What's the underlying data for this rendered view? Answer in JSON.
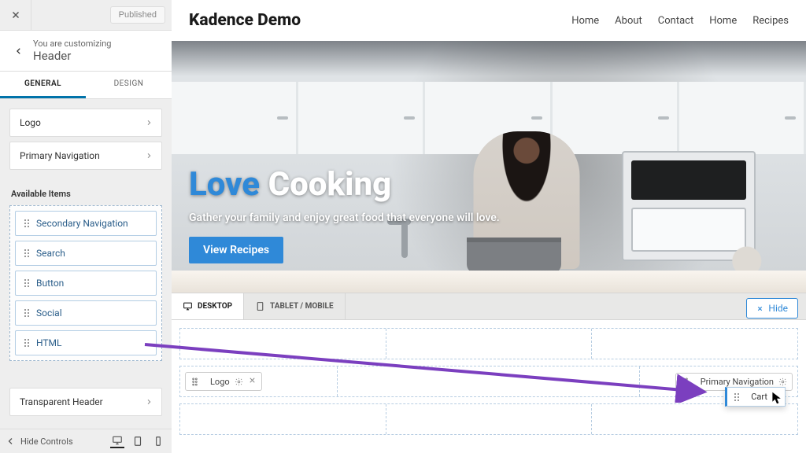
{
  "topbar": {
    "published": "Published"
  },
  "section": {
    "eyebrow": "You are customizing",
    "title": "Header"
  },
  "tabs": {
    "general": "GENERAL",
    "design": "DESIGN"
  },
  "active_items": [
    {
      "label": "Logo"
    },
    {
      "label": "Primary Navigation"
    }
  ],
  "available_label": "Available Items",
  "available_items": [
    {
      "label": "Secondary Navigation"
    },
    {
      "label": "Search"
    },
    {
      "label": "Button"
    },
    {
      "label": "Social"
    },
    {
      "label": "HTML"
    }
  ],
  "transparent_header": "Transparent Header",
  "footer": {
    "hide_controls": "Hide Controls"
  },
  "site": {
    "title": "Kadence Demo",
    "nav": [
      "Home",
      "About",
      "Contact",
      "Home",
      "Recipes"
    ]
  },
  "hero": {
    "word1": "Love",
    "word2": "Cooking",
    "sub": "Gather your family and enjoy great food that everyone will love.",
    "cta": "View Recipes"
  },
  "device_tabs": {
    "desktop": "DESKTOP",
    "tablet": "TABLET / MOBILE"
  },
  "hide_label": "Hide",
  "builder_main": {
    "left": "Logo",
    "right": "Primary Navigation"
  },
  "drop_item": "Cart"
}
